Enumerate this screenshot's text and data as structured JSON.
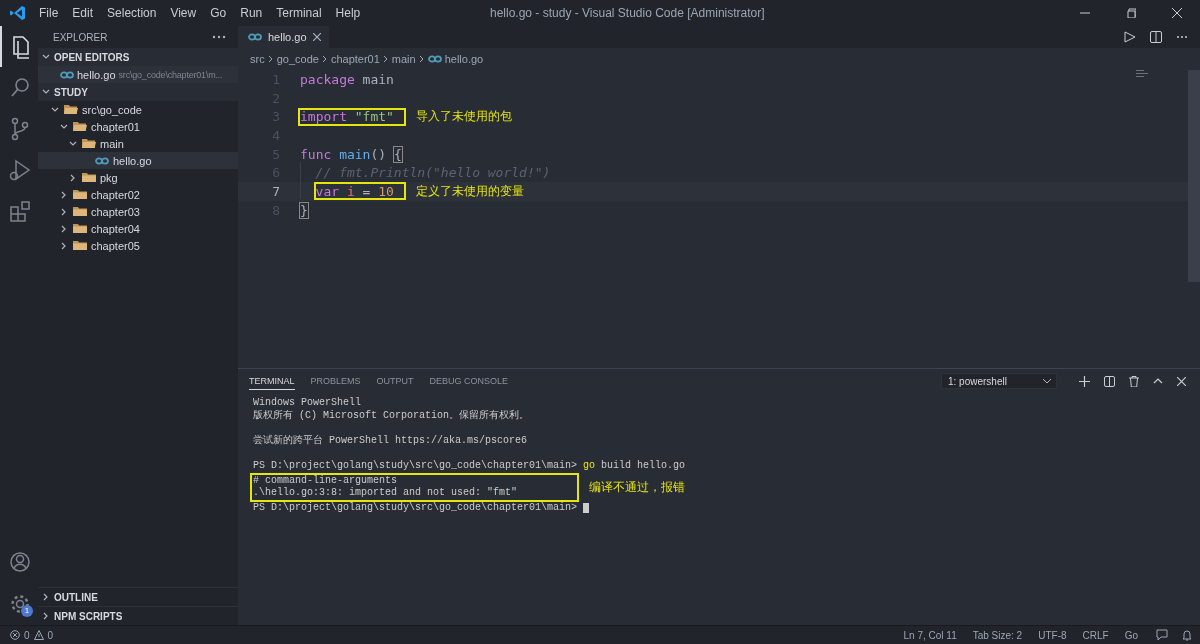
{
  "window": {
    "title": "hello.go - study - Visual Studio Code [Administrator]"
  },
  "menu": [
    "File",
    "Edit",
    "Selection",
    "View",
    "Go",
    "Run",
    "Terminal",
    "Help"
  ],
  "activity_bar": {
    "items": [
      {
        "kind": "files",
        "selected": true
      },
      {
        "kind": "search",
        "selected": false
      },
      {
        "kind": "source-control",
        "selected": false
      },
      {
        "kind": "run",
        "selected": false
      },
      {
        "kind": "extensions",
        "selected": false
      }
    ],
    "bottom": [
      {
        "kind": "account"
      },
      {
        "kind": "settings",
        "badge": "1"
      }
    ]
  },
  "sidebar": {
    "title": "EXPLORER",
    "open_editors": {
      "title": "OPEN EDITORS",
      "expanded": true,
      "items": [
        {
          "name": "hello.go",
          "path": "src\\go_code\\chapter01\\m..."
        }
      ]
    },
    "folder": {
      "title": "STUDY",
      "expanded": true,
      "tree": [
        {
          "name": "src\\go_code",
          "kind": "folder",
          "expanded": true,
          "selected": false,
          "children": [
            {
              "name": "chapter01",
              "kind": "folder",
              "expanded": true,
              "selected": false,
              "children": [
                {
                  "name": "main",
                  "kind": "folder",
                  "expanded": true,
                  "selected": false,
                  "children": [
                    {
                      "name": "hello.go",
                      "kind": "go-file",
                      "selected": true
                    }
                  ]
                },
                {
                  "name": "pkg",
                  "kind": "folder",
                  "expanded": false,
                  "selected": false
                }
              ]
            },
            {
              "name": "chapter02",
              "kind": "folder",
              "expanded": false,
              "selected": false
            },
            {
              "name": "chapter03",
              "kind": "folder",
              "expanded": false,
              "selected": false
            },
            {
              "name": "chapter04",
              "kind": "folder",
              "expanded": false,
              "selected": false
            },
            {
              "name": "chapter05",
              "kind": "folder",
              "expanded": false,
              "selected": false
            }
          ]
        }
      ]
    },
    "bottom_sections": [
      {
        "title": "OUTLINE",
        "expanded": false
      },
      {
        "title": "NPM SCRIPTS",
        "expanded": false
      }
    ]
  },
  "editor": {
    "tabs": [
      {
        "label": "hello.go",
        "selected": true
      }
    ],
    "breadcrumbs": [
      "src",
      "go_code",
      "chapter01",
      "main",
      "hello.go"
    ],
    "lines": [
      {
        "number": "1",
        "current": false,
        "tokens": [
          {
            "kind": "keyword",
            "text": "package"
          },
          {
            "kind": "plain",
            "text": " main"
          }
        ]
      },
      {
        "number": "2",
        "current": false
      },
      {
        "number": "3",
        "current": false,
        "boxed": true,
        "note": "导入了未使用的包",
        "tokens": [
          {
            "kind": "keyword",
            "text": "import"
          },
          {
            "kind": "string",
            "text": " \"fmt\""
          }
        ]
      },
      {
        "number": "4",
        "current": false
      },
      {
        "number": "5",
        "current": false,
        "tokens": [
          {
            "kind": "keyword",
            "text": "func"
          },
          {
            "kind": "function",
            "text": " main"
          },
          {
            "kind": "plain",
            "text": "() "
          },
          {
            "kind": "bracket",
            "text": "{"
          }
        ],
        "children": [
          {
            "number": "6",
            "current": false,
            "tokens": [
              {
                "kind": "comment",
                "text": "// fmt.Println(\"hello world!\")"
              }
            ]
          },
          {
            "number": "7",
            "current": true,
            "boxed": true,
            "note": "定义了未使用的变量",
            "tokens": [
              {
                "kind": "keyword",
                "text": "var"
              },
              {
                "kind": "variable",
                "text": " i"
              },
              {
                "kind": "plain",
                "text": " = "
              },
              {
                "kind": "number",
                "text": "10"
              }
            ]
          }
        ]
      },
      {
        "number": "8",
        "current": false,
        "tokens": [
          {
            "kind": "bracket",
            "text": "}"
          }
        ]
      }
    ]
  },
  "panel": {
    "tabs": [
      {
        "label": "TERMINAL",
        "selected": true
      },
      {
        "label": "PROBLEMS",
        "selected": false
      },
      {
        "label": "OUTPUT",
        "selected": false
      },
      {
        "label": "DEBUG CONSOLE",
        "selected": false
      }
    ],
    "terminal_select": "1: powershell",
    "terminal": [
      {
        "kind": "line",
        "segments": [
          {
            "kind": "text",
            "text": "Windows PowerShell"
          }
        ]
      },
      {
        "kind": "line",
        "segments": [
          {
            "kind": "text",
            "text": "版权所有 (C) Microsoft Corporation。保留所有权利。"
          }
        ]
      },
      {
        "kind": "blank"
      },
      {
        "kind": "line",
        "segments": [
          {
            "kind": "text",
            "text": "尝试新的跨平台 PowerShell https://aka.ms/pscore6"
          }
        ]
      },
      {
        "kind": "blank"
      },
      {
        "kind": "line",
        "segments": [
          {
            "kind": "text",
            "text": "PS D:\\project\\golang\\study\\src\\go_code\\chapter01\\main>"
          },
          {
            "kind": "command",
            "text": "go"
          },
          {
            "kind": "text",
            "text": "build hello.go"
          }
        ]
      },
      {
        "kind": "boxed",
        "note": "编译不通过，报错",
        "lines": [
          {
            "kind": "line",
            "segments": [
              {
                "kind": "text",
                "text": "# command-line-arguments"
              }
            ]
          },
          {
            "kind": "line",
            "segments": [
              {
                "kind": "text",
                "text": ".\\hello.go:3:8: imported and not used: \"fmt\""
              }
            ]
          }
        ]
      },
      {
        "kind": "line",
        "cursor": true,
        "segments": [
          {
            "kind": "text",
            "text": "PS D:\\project\\golang\\study\\src\\go_code\\chapter01\\main>"
          }
        ]
      }
    ]
  },
  "status_bar": {
    "errors": "0",
    "warnings": "0",
    "items": [
      "Ln 7, Col 11",
      "Tab Size: 2",
      "UTF-8",
      "CRLF",
      "Go"
    ]
  }
}
